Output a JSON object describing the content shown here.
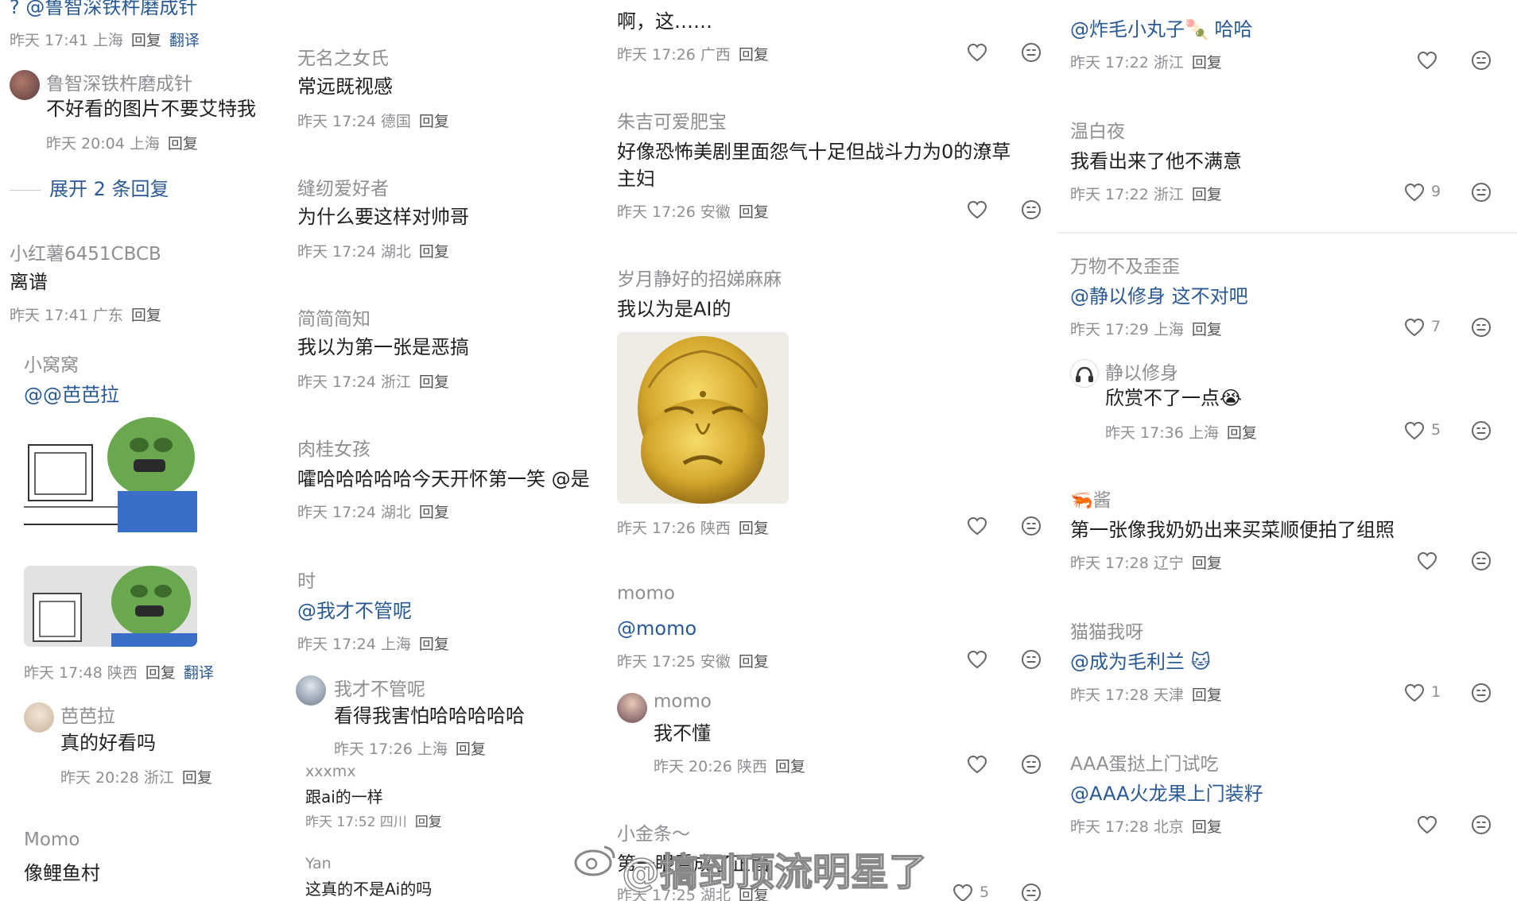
{
  "reply": "回复",
  "translate": "翻译",
  "col1": {
    "c0": {
      "text": "? @鲁智深铁杵磨成针",
      "meta": "昨天 17:41 上海"
    },
    "c1": {
      "user": "鲁智深铁杵磨成针",
      "text": "不好看的图片不要艾特我",
      "meta": "昨天 20:04 上海"
    },
    "expand": "展开 2 条回复",
    "c2": {
      "user": "小红薯6451CBCB",
      "text": "离谱",
      "meta": "昨天 17:41 广东"
    },
    "c3": {
      "user": "小窝窝",
      "text": "@@芭芭拉",
      "meta": "昨天 17:48 陕西"
    },
    "c4": {
      "user": "芭芭拉",
      "text": "真的好看吗",
      "meta": "昨天 20:28 浙江"
    },
    "c5": {
      "user": "Momo",
      "text": "像鲤鱼村"
    }
  },
  "col2": {
    "c1": {
      "user": "无名之女氏",
      "text": "常远既视感",
      "meta": "昨天 17:24 德国"
    },
    "c2": {
      "user": "缝纫爱好者",
      "text": "为什么要这样对帅哥",
      "meta": "昨天 17:24 湖北"
    },
    "c3": {
      "user": "简简简知",
      "text": "我以为第一张是恶搞",
      "meta": "昨天 17:24 浙江"
    },
    "c4": {
      "user": "肉桂女孩",
      "text": "嚯哈哈哈哈哈今天开怀第一笑 @是",
      "meta": "昨天 17:24 湖北"
    },
    "c5": {
      "user": "时",
      "text": "@我才不管呢",
      "meta": "昨天 17:24 上海"
    },
    "c6": {
      "user": "我才不管呢",
      "text": "看得我害怕哈哈哈哈哈",
      "meta": "昨天 17:26 上海"
    },
    "c7": {
      "user": "xxxmx",
      "text": "跟ai的一样",
      "meta": "昨天 17:52 四川"
    },
    "c8": {
      "user": "Yan",
      "text": "这真的不是Ai的吗"
    }
  },
  "col3": {
    "c1": {
      "text": "啊，这……",
      "meta": "昨天 17:26 广西"
    },
    "c2": {
      "user": "朱吉可爱肥宝",
      "text1": "好像恐怖美剧里面怨气十足但战斗力为0的潦草",
      "text2": "主妇",
      "meta": "昨天 17:26 安徽"
    },
    "c3": {
      "user": "岁月静好的招娣麻麻",
      "text": "我以为是AI的",
      "meta": "昨天 17:26 陕西"
    },
    "c4": {
      "user": "momo",
      "text": "@momo",
      "meta": "昨天 17:25 安徽"
    },
    "c5": {
      "user": "momo",
      "text": "我不懂",
      "meta": "昨天 20:26 陕西"
    },
    "c6": {
      "user": "小金条～",
      "text": "第一眼看成了正面",
      "meta": "昨天 17:25 湖北",
      "likes": "5"
    }
  },
  "col4": {
    "c1": {
      "text": "@炸毛小丸子🍡 哈哈",
      "meta": "昨天 17:22 浙江"
    },
    "c2": {
      "user": "温白夜",
      "text": "我看出来了他不满意",
      "meta": "昨天 17:22 浙江",
      "likes": "9"
    },
    "c3": {
      "user": "万物不及歪歪",
      "text": "@静以修身 这不对吧",
      "meta": "昨天 17:29 上海",
      "likes": "7"
    },
    "c4": {
      "user": "静以修身",
      "text": "欣赏不了一点😭",
      "meta": "昨天 17:36 上海",
      "likes": "5"
    },
    "c5": {
      "user": "🦐酱",
      "text": "第一张像我奶奶出来买菜顺便拍了组照",
      "meta": "昨天 17:28 辽宁"
    },
    "c6": {
      "user": "猫猫我呀",
      "text": "@成为毛利兰 🐱",
      "meta": "昨天 17:28 天津",
      "likes": "1"
    },
    "c7": {
      "user": "AAA蛋挞上门试吃",
      "text": "@AAA火龙果上门装籽",
      "meta": "昨天 17:28 北京"
    }
  },
  "watermark": "@搞到顶流明星了",
  "colors": {
    "link": "#2a5a96",
    "meta": "#8e8e93",
    "text": "#1f1f1f"
  }
}
